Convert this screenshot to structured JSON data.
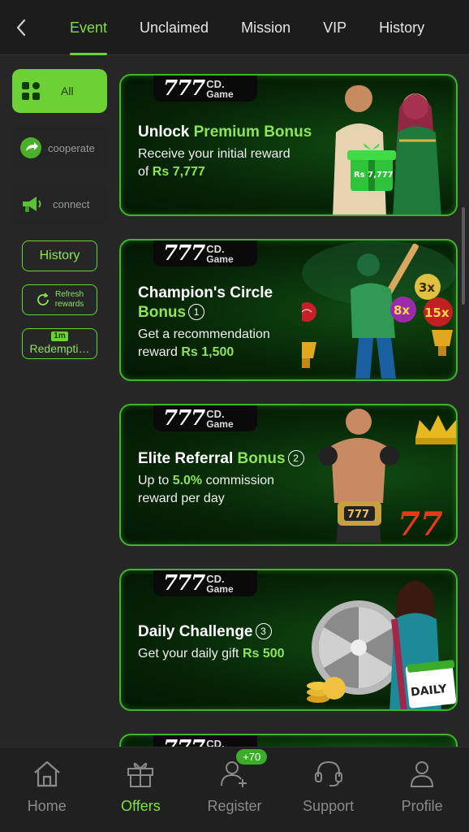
{
  "colors": {
    "accent": "#6cd134",
    "background": "#262626",
    "banner_border": "#3fb52c"
  },
  "header": {
    "back_icon": "chevron-left-icon",
    "tabs": [
      {
        "label": "Event",
        "active": true
      },
      {
        "label": "Unclaimed",
        "active": false
      },
      {
        "label": "Mission",
        "active": false
      },
      {
        "label": "VIP",
        "active": false
      },
      {
        "label": "History",
        "active": false
      }
    ]
  },
  "sidebar": {
    "categories": [
      {
        "label": "All",
        "icon": "grid-icon",
        "active": true
      },
      {
        "label": "cooperate",
        "icon": "share-arrow-icon",
        "active": false
      },
      {
        "label": "connect",
        "icon": "megaphone-icon",
        "active": false
      }
    ],
    "history_label": "History",
    "refresh_label_1": "Refresh",
    "refresh_label_2": "rewards",
    "redeem_icon_text": "1m",
    "redeem_label": "Redempti…"
  },
  "brand": {
    "number": "777",
    "suffix": "CD.",
    "sub": "Game"
  },
  "banners": [
    {
      "title_plain": "Unlock ",
      "title_highlight": "Premium Bonus",
      "desc_1": "Receive your initial reward",
      "desc_2_plain": "of ",
      "desc_2_highlight": "Rs 7,777",
      "gift_text": "Rs 7,777"
    },
    {
      "title_plain": "Champion's Circle",
      "title_highlight": "Bonus",
      "number": "1",
      "desc_1": "Get a recommendation",
      "desc_2_plain": "reward ",
      "desc_2_highlight": "Rs 1,500",
      "multipliers": [
        "3x",
        "8x",
        "15x"
      ]
    },
    {
      "title_plain": "Elite Referral ",
      "title_highlight": "Bonus",
      "number": "2",
      "desc_1_plain": "Up to ",
      "desc_1_highlight": "5.0%",
      "desc_1_rest": " commission",
      "desc_2": "reward per day",
      "belt_text": "777",
      "sevens_text": "77"
    },
    {
      "title_plain": "Daily Challenge",
      "number": "3",
      "desc_1_plain": "Get your daily gift ",
      "desc_1_highlight": "Rs 500",
      "card_text": "DAILY"
    }
  ],
  "bottom_nav": {
    "items": [
      {
        "label": "Home",
        "icon": "home-icon",
        "active": false
      },
      {
        "label": "Offers",
        "icon": "gift-icon",
        "active": true
      },
      {
        "label": "Register",
        "icon": "add-user-icon",
        "active": false,
        "badge": "+70"
      },
      {
        "label": "Support",
        "icon": "headset-icon",
        "active": false
      },
      {
        "label": "Profile",
        "icon": "user-icon",
        "active": false
      }
    ]
  }
}
